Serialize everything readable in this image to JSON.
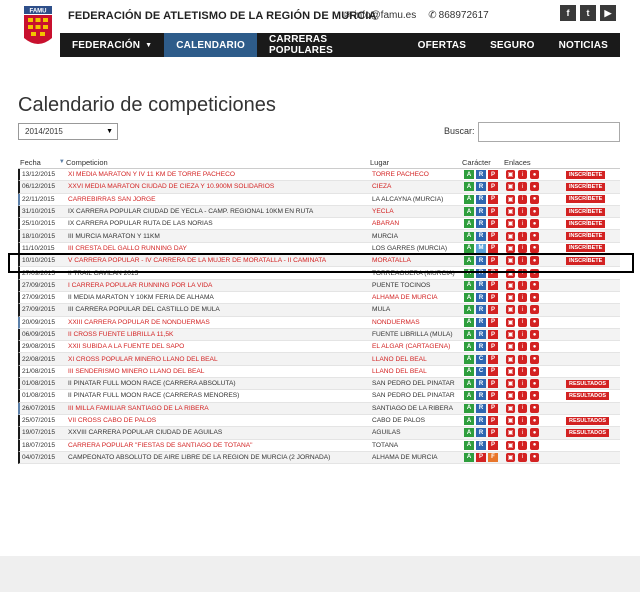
{
  "header": {
    "title": "FEDERACIÓN DE ATLETISMO DE LA REGIÓN DE MURCIA",
    "email": "info@famu.es",
    "phone": "868972617",
    "logo_text": "FAMU",
    "social": [
      {
        "name": "facebook",
        "label": "f"
      },
      {
        "name": "twitter",
        "label": "t"
      },
      {
        "name": "youtube",
        "label": "▶"
      }
    ]
  },
  "nav": {
    "items": [
      {
        "label": "FEDERACIÓN",
        "caret": true
      },
      {
        "label": "CALENDARIO",
        "active": true
      },
      {
        "label": "CARRERAS POPULARES"
      },
      {
        "label": "OFERTAS"
      },
      {
        "label": "SEGURO"
      },
      {
        "label": "NOTICIAS"
      }
    ]
  },
  "page": {
    "title": "Calendario de competiciones",
    "season_select": "2014/2015",
    "search_label": "Buscar:",
    "search_value": ""
  },
  "table": {
    "headers": [
      "Fecha",
      "Competicion",
      "Lugar",
      "Carácter",
      "Enlaces"
    ],
    "rows": [
      {
        "date": "13/12/2015",
        "comp": "XI MEDIA MARATÓN Y IV 11 KM DE TORRE PACHECO",
        "comp_red": true,
        "lugar": "TORRE PACHECO",
        "lugar_red": true,
        "car": [
          "A",
          "R",
          "P"
        ],
        "enl": 3,
        "action": "INSCRÍBETE"
      },
      {
        "date": "06/12/2015",
        "comp": "XXVI MEDIA MARATÓN CIUDAD DE CIEZA Y 10.900M SOLIDARIOS",
        "comp_red": true,
        "lugar": "CIEZA",
        "lugar_red": true,
        "car": [
          "A",
          "R",
          "P"
        ],
        "enl": 3,
        "action": "INSCRÍBETE"
      },
      {
        "date": "22/11/2015",
        "comp": "CARREBIRRAS SAN JORGE",
        "comp_red": true,
        "lugar": "LA ALCAYNA (MURCIA)",
        "lugar_red": false,
        "car": [
          "A",
          "R",
          "P"
        ],
        "enl": 3,
        "action": "INSCRÍBETE"
      },
      {
        "date": "31/10/2015",
        "comp": "IX CARRERA POPULAR CIUDAD DE YECLA - CAMP. REGIONAL 10KM EN RUTA",
        "comp_red": false,
        "lugar": "YECLA",
        "lugar_red": true,
        "car": [
          "A",
          "R",
          "P"
        ],
        "enl": 3,
        "action": "INSCRÍBETE"
      },
      {
        "date": "25/10/2015",
        "comp": "IX CARRERA POPULAR RUTA DE LAS NORIAS",
        "comp_red": false,
        "lugar": "ABARÁN",
        "lugar_red": true,
        "car": [
          "A",
          "R",
          "P"
        ],
        "enl": 3,
        "action": "INSCRÍBETE"
      },
      {
        "date": "18/10/2015",
        "comp": "III MURCIA MARATÓN Y 11KM",
        "comp_red": false,
        "lugar": "MURCIA",
        "lugar_red": false,
        "car": [
          "A",
          "R",
          "P"
        ],
        "enl": 3,
        "action": "INSCRÍBETE"
      },
      {
        "date": "11/10/2015",
        "comp": "III CRESTA DEL GALLO RUNNING DAY",
        "comp_red": true,
        "lugar": "LOS GARRES (MURCIA)",
        "lugar_red": false,
        "car": [
          "A",
          "M",
          "P"
        ],
        "enl": 3,
        "action": "INSCRÍBETE"
      },
      {
        "date": "10/10/2015",
        "comp": "V CARRERA POPULAR - IV CARRERA DE LA MUJER DE MORATALLA - II CAMINATA",
        "comp_red": true,
        "lugar": "MORATALLA",
        "lugar_red": true,
        "car": [
          "A",
          "R",
          "P"
        ],
        "enl": 3,
        "action": "INSCRÍBETE"
      },
      {
        "date": "27/09/2015",
        "comp": "II TRAIL GAVILÁN 2015",
        "comp_red": false,
        "lugar": "TORREAGÜERA (MURCIA)",
        "lugar_red": false,
        "car": [
          "A",
          "R",
          "P"
        ],
        "enl": 3,
        "action": ""
      },
      {
        "date": "27/09/2015",
        "comp": "I CARRERA POPULAR RUNNING POR LA VIDA",
        "comp_red": true,
        "lugar": "PUENTE TOCINOS",
        "lugar_red": false,
        "car": [
          "A",
          "R",
          "P"
        ],
        "enl": 3,
        "action": ""
      },
      {
        "date": "27/09/2015",
        "comp": "II MEDIA MARATÓN Y 10KM FERIA DE ALHAMA",
        "comp_red": false,
        "lugar": "ALHAMA DE MURCIA",
        "lugar_red": true,
        "car": [
          "A",
          "R",
          "P"
        ],
        "enl": 3,
        "action": ""
      },
      {
        "date": "27/09/2015",
        "comp": "III CARRERA POPULAR DEL CASTILLO DE MULA",
        "comp_red": false,
        "lugar": "MULA",
        "lugar_red": false,
        "car": [
          "A",
          "R",
          "P"
        ],
        "enl": 3,
        "action": ""
      },
      {
        "date": "20/09/2015",
        "comp": "XXIII CARRERA POPULAR DE NONDUERMAS",
        "comp_red": true,
        "lugar": "NONDUERMAS",
        "lugar_red": true,
        "car": [
          "A",
          "R",
          "P"
        ],
        "enl": 3,
        "action": ""
      },
      {
        "date": "06/09/2015",
        "comp": "II CROSS FUENTE LIBRILLA 11,5K",
        "comp_red": true,
        "lugar": "FUENTE LIBRILLA (MULA)",
        "lugar_red": false,
        "car": [
          "A",
          "R",
          "P"
        ],
        "enl": 3,
        "action": ""
      },
      {
        "date": "29/08/2015",
        "comp": "XXII SUBIDA A LA FUENTE DEL SAPO",
        "comp_red": true,
        "lugar": "EL ALGAR (CARTAGENA)",
        "lugar_red": true,
        "car": [
          "A",
          "R",
          "P"
        ],
        "enl": 3,
        "action": ""
      },
      {
        "date": "22/08/2015",
        "comp": "XI CROSS POPULAR MINERO LLANO DEL BEAL",
        "comp_red": true,
        "lugar": "LLANO DEL BEAL",
        "lugar_red": true,
        "car": [
          "A",
          "C",
          "P"
        ],
        "enl": 3,
        "action": ""
      },
      {
        "date": "21/08/2015",
        "comp": "III SENDERISMO MINERO LLANO DEL BEAL",
        "comp_red": true,
        "lugar": "LLANO DEL BEAL",
        "lugar_red": true,
        "car": [
          "A",
          "C",
          "P"
        ],
        "enl": 3,
        "action": ""
      },
      {
        "date": "01/08/2015",
        "comp": "II PINATAR FULL MOON RACE (CARRERA ABSOLUTA)",
        "comp_red": false,
        "lugar": "SAN PEDRO DEL PINATAR",
        "lugar_red": false,
        "car": [
          "A",
          "R",
          "P"
        ],
        "enl": 3,
        "action": "RESULTADOS"
      },
      {
        "date": "01/08/2015",
        "comp": "II PINATAR FULL MOON RACE (CARRERAS MENORES)",
        "comp_red": false,
        "lugar": "SAN PEDRO DEL PINATAR",
        "lugar_red": false,
        "car": [
          "A",
          "R",
          "P"
        ],
        "enl": 3,
        "action": "RESULTADOS"
      },
      {
        "date": "26/07/2015",
        "comp": "III MILLA FAMILIAR SANTIAGO DE LA RIBERA",
        "comp_red": true,
        "lugar": "SANTIAGO DE LA RIBERA",
        "lugar_red": false,
        "car": [
          "A",
          "R",
          "P"
        ],
        "enl": 3,
        "action": ""
      },
      {
        "date": "25/07/2015",
        "comp": "VII CROSS CABO DE PALOS",
        "comp_red": true,
        "lugar": "CABO DE PALOS",
        "lugar_red": false,
        "car": [
          "A",
          "R",
          "P"
        ],
        "enl": 3,
        "action": "RESULTADOS"
      },
      {
        "date": "19/07/2015",
        "comp": "XXVIII CARRERA POPULAR CIUDAD DE ÁGUILAS",
        "comp_red": false,
        "lugar": "ÁGUILAS",
        "lugar_red": false,
        "car": [
          "A",
          "R",
          "P"
        ],
        "enl": 3,
        "action": "RESULTADOS"
      },
      {
        "date": "18/07/2015",
        "comp": "CARRERA POPULAR \"FIESTAS DE SANTIAGO DE TOTANA\"",
        "comp_red": true,
        "lugar": "TOTANA",
        "lugar_red": false,
        "car": [
          "A",
          "R",
          "P"
        ],
        "enl": 3,
        "action": ""
      },
      {
        "date": "04/07/2015",
        "comp": "CAMPEONATO ABSOLUTO DE AIRE LIBRE DE LA REGIÓN DE MURCIA (2 JORNADA)",
        "comp_red": false,
        "lugar": "ALHAMA DE MURCIA",
        "lugar_red": false,
        "car": [
          "A",
          "P",
          "F"
        ],
        "enl": 3,
        "action": ""
      }
    ]
  },
  "colors": {
    "accent_red": "#d32222",
    "nav_bg": "#1a1a1a",
    "nav_active": "#2e5c8a"
  }
}
